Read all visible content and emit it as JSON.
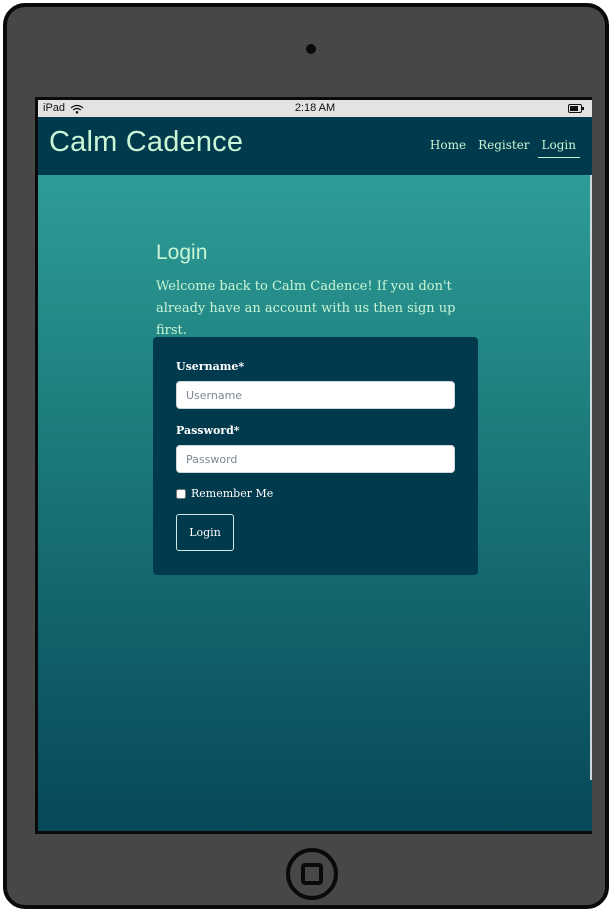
{
  "status_bar": {
    "device": "iPad",
    "time": "2:18 AM"
  },
  "navbar": {
    "brand": "Calm Cadence",
    "links": [
      {
        "label": "Home",
        "active": false
      },
      {
        "label": "Register",
        "active": false
      },
      {
        "label": "Login",
        "active": true
      }
    ]
  },
  "page": {
    "title": "Login",
    "intro": "Welcome back to Calm Cadence! If you don't already have an account with us then sign up first."
  },
  "form": {
    "username_label": "Username*",
    "username_placeholder": "Username",
    "username_value": "",
    "password_label": "Password*",
    "password_placeholder": "Password",
    "password_value": "",
    "remember_label": "Remember Me",
    "remember_checked": false,
    "submit_label": "Login"
  },
  "icons": {
    "wifi": "wifi-icon",
    "battery": "battery-icon",
    "home_button": "home-button-icon"
  },
  "colors": {
    "navbar_bg": "#003a4c",
    "accent_text": "#c9f5d6",
    "gradient_top": "#32a6a0",
    "gradient_bottom": "#07485a"
  }
}
